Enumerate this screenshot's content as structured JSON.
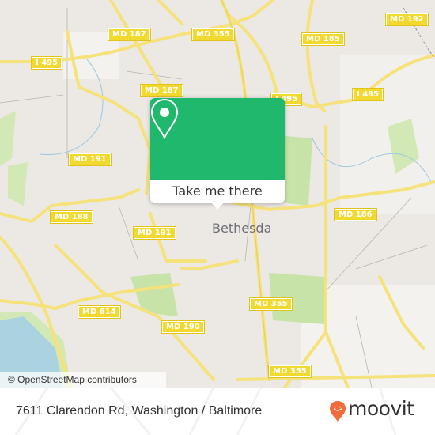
{
  "map": {
    "place_label": "Bethesda",
    "road_shields": [
      {
        "id": "md187-top",
        "label": "MD 187"
      },
      {
        "id": "md355-top",
        "label": "MD 355"
      },
      {
        "id": "md185",
        "label": "MD 185"
      },
      {
        "id": "md192",
        "label": "MD 192"
      },
      {
        "id": "i495-west",
        "label": "I 495"
      },
      {
        "id": "md187-mid",
        "label": "MD 187"
      },
      {
        "id": "i495-mid",
        "label": "I 495"
      },
      {
        "id": "i495-east",
        "label": "I 495"
      },
      {
        "id": "md191-north",
        "label": "MD 191"
      },
      {
        "id": "md188",
        "label": "MD 188"
      },
      {
        "id": "md191-south",
        "label": "MD 191"
      },
      {
        "id": "md186",
        "label": "MD 186"
      },
      {
        "id": "md614",
        "label": "MD 614"
      },
      {
        "id": "md190",
        "label": "MD 190"
      },
      {
        "id": "md355-mid",
        "label": "MD 355"
      },
      {
        "id": "md355-south",
        "label": "MD 355"
      }
    ],
    "attribution": "© OpenStreetMap contributors",
    "colors": {
      "land": "#ece8e4",
      "park": "#c8e3a8",
      "road": "#f6e27a",
      "water": "#aad3df",
      "shield": "#f1d92f"
    }
  },
  "popup": {
    "icon": "map-pin-icon",
    "button_label": "Take me there",
    "accent_color": "#1fb86c"
  },
  "footer": {
    "address": "7611 Clarendon Rd, Washington / Baltimore",
    "brand": "moovit",
    "brand_icon": "moovit-pin-icon",
    "brand_color": "#f26b3a"
  }
}
